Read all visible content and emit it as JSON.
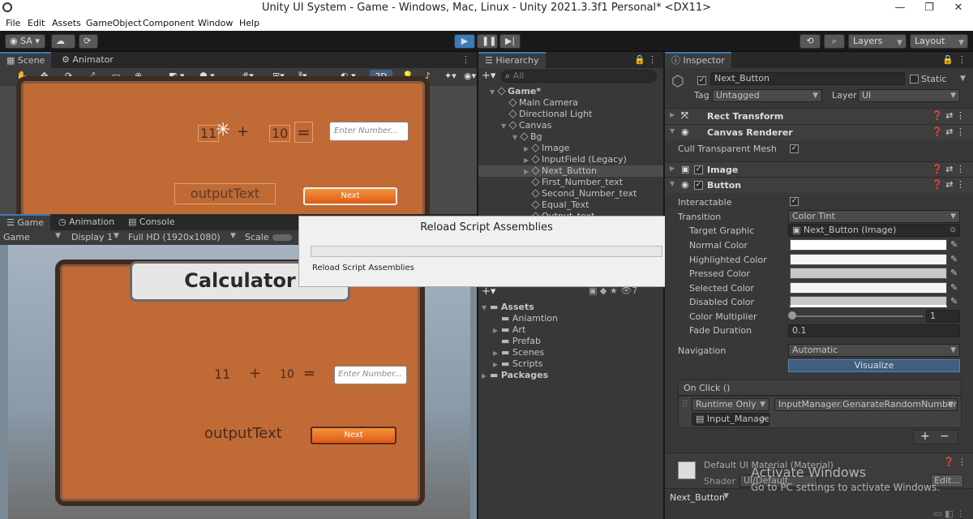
{
  "window": {
    "title": "Unity UI System - Game - Windows, Mac, Linux - Unity 2021.3.3f1 Personal* <DX11>"
  },
  "menu": [
    "File",
    "Edit",
    "Assets",
    "GameObject",
    "Component",
    "Window",
    "Help"
  ],
  "toolbar": {
    "account": "SA",
    "layers": "Layers",
    "layout": "Layout"
  },
  "scene": {
    "tabs": [
      "Scene",
      "Animator"
    ],
    "num1": "11",
    "op": "+",
    "num2": "10",
    "eq": "=",
    "input_placeholder": "Enter Number...",
    "output": "outputText",
    "next": "Next",
    "mode2d": "2D"
  },
  "game": {
    "tabs": [
      "Game",
      "Animation",
      "Console"
    ],
    "display_mode": "Game",
    "display": "Display 1",
    "resolution": "Full HD (1920x1080)",
    "scale": "Scale",
    "title": "Calculator",
    "num1": "11",
    "op": "+",
    "num2": "10",
    "eq": "=",
    "input_placeholder": "Enter Number...",
    "output": "outputText",
    "next": "Next"
  },
  "dialog": {
    "title": "Reload Script Assemblies",
    "message": "Reload Script Assemblies"
  },
  "hierarchy": {
    "tab": "Hierarchy",
    "search_placeholder": "All",
    "items": [
      {
        "label": "Game*",
        "level": 0
      },
      {
        "label": "Main Camera",
        "level": 1
      },
      {
        "label": "Directional Light",
        "level": 1
      },
      {
        "label": "Canvas",
        "level": 1
      },
      {
        "label": "Bg",
        "level": 2
      },
      {
        "label": "Image",
        "level": 3
      },
      {
        "label": "InputField (Legacy)",
        "level": 3
      },
      {
        "label": "Next_Button",
        "level": 3
      },
      {
        "label": "First_Number_text",
        "level": 3
      },
      {
        "label": "Second_Number_text",
        "level": 3
      },
      {
        "label": "Equal_Text",
        "level": 3
      },
      {
        "label": "Output_text",
        "level": 3
      }
    ]
  },
  "project": {
    "count": "7",
    "items": [
      {
        "label": "Assets",
        "level": 0
      },
      {
        "label": "Aniamtion",
        "level": 1
      },
      {
        "label": "Art",
        "level": 1
      },
      {
        "label": "Prefab",
        "level": 1
      },
      {
        "label": "Scenes",
        "level": 1
      },
      {
        "label": "Scripts",
        "level": 1
      },
      {
        "label": "Packages",
        "level": 0
      }
    ]
  },
  "inspector": {
    "tab": "Inspector",
    "object_name": "Next_Button",
    "static": "Static",
    "tag_label": "Tag",
    "tag": "Untagged",
    "layer_label": "Layer",
    "layer": "UI",
    "components": [
      "Rect Transform",
      "Canvas Renderer",
      "Image",
      "Button"
    ],
    "cull_label": "Cull Transparent Mesh",
    "interactable_label": "Interactable",
    "transition_label": "Transition",
    "transition": "Color Tint",
    "target_graphic_label": "Target Graphic",
    "target_graphic": "Next_Button (Image)",
    "normal_label": "Normal Color",
    "highlighted_label": "Highlighted Color",
    "pressed_label": "Pressed Color",
    "selected_label": "Selected Color",
    "disabled_label": "Disabled Color",
    "multiplier_label": "Color Multiplier",
    "multiplier": "1",
    "fade_label": "Fade Duration",
    "fade": "0.1",
    "navigation_label": "Navigation",
    "navigation": "Automatic",
    "visualize": "Visualize",
    "onclick_label": "On Click ()",
    "runtime": "Runtime Only",
    "function": "InputManager.GenarateRandomNumber",
    "object_ref": "Input_Manage",
    "plus": "+",
    "minus": "−",
    "material": "Default UI Material (Material)",
    "shader_label": "Shader",
    "shader": "UI/Default",
    "edit": "Edit...",
    "footer": "Next_Button"
  },
  "watermark": {
    "line1": "Activate Windows",
    "line2": "Go to PC settings to activate Windows."
  },
  "colors": {
    "accent": "#3a79bb",
    "panel": "#383838",
    "wood": "#c06a36",
    "button_orange": "#f07a2c"
  }
}
